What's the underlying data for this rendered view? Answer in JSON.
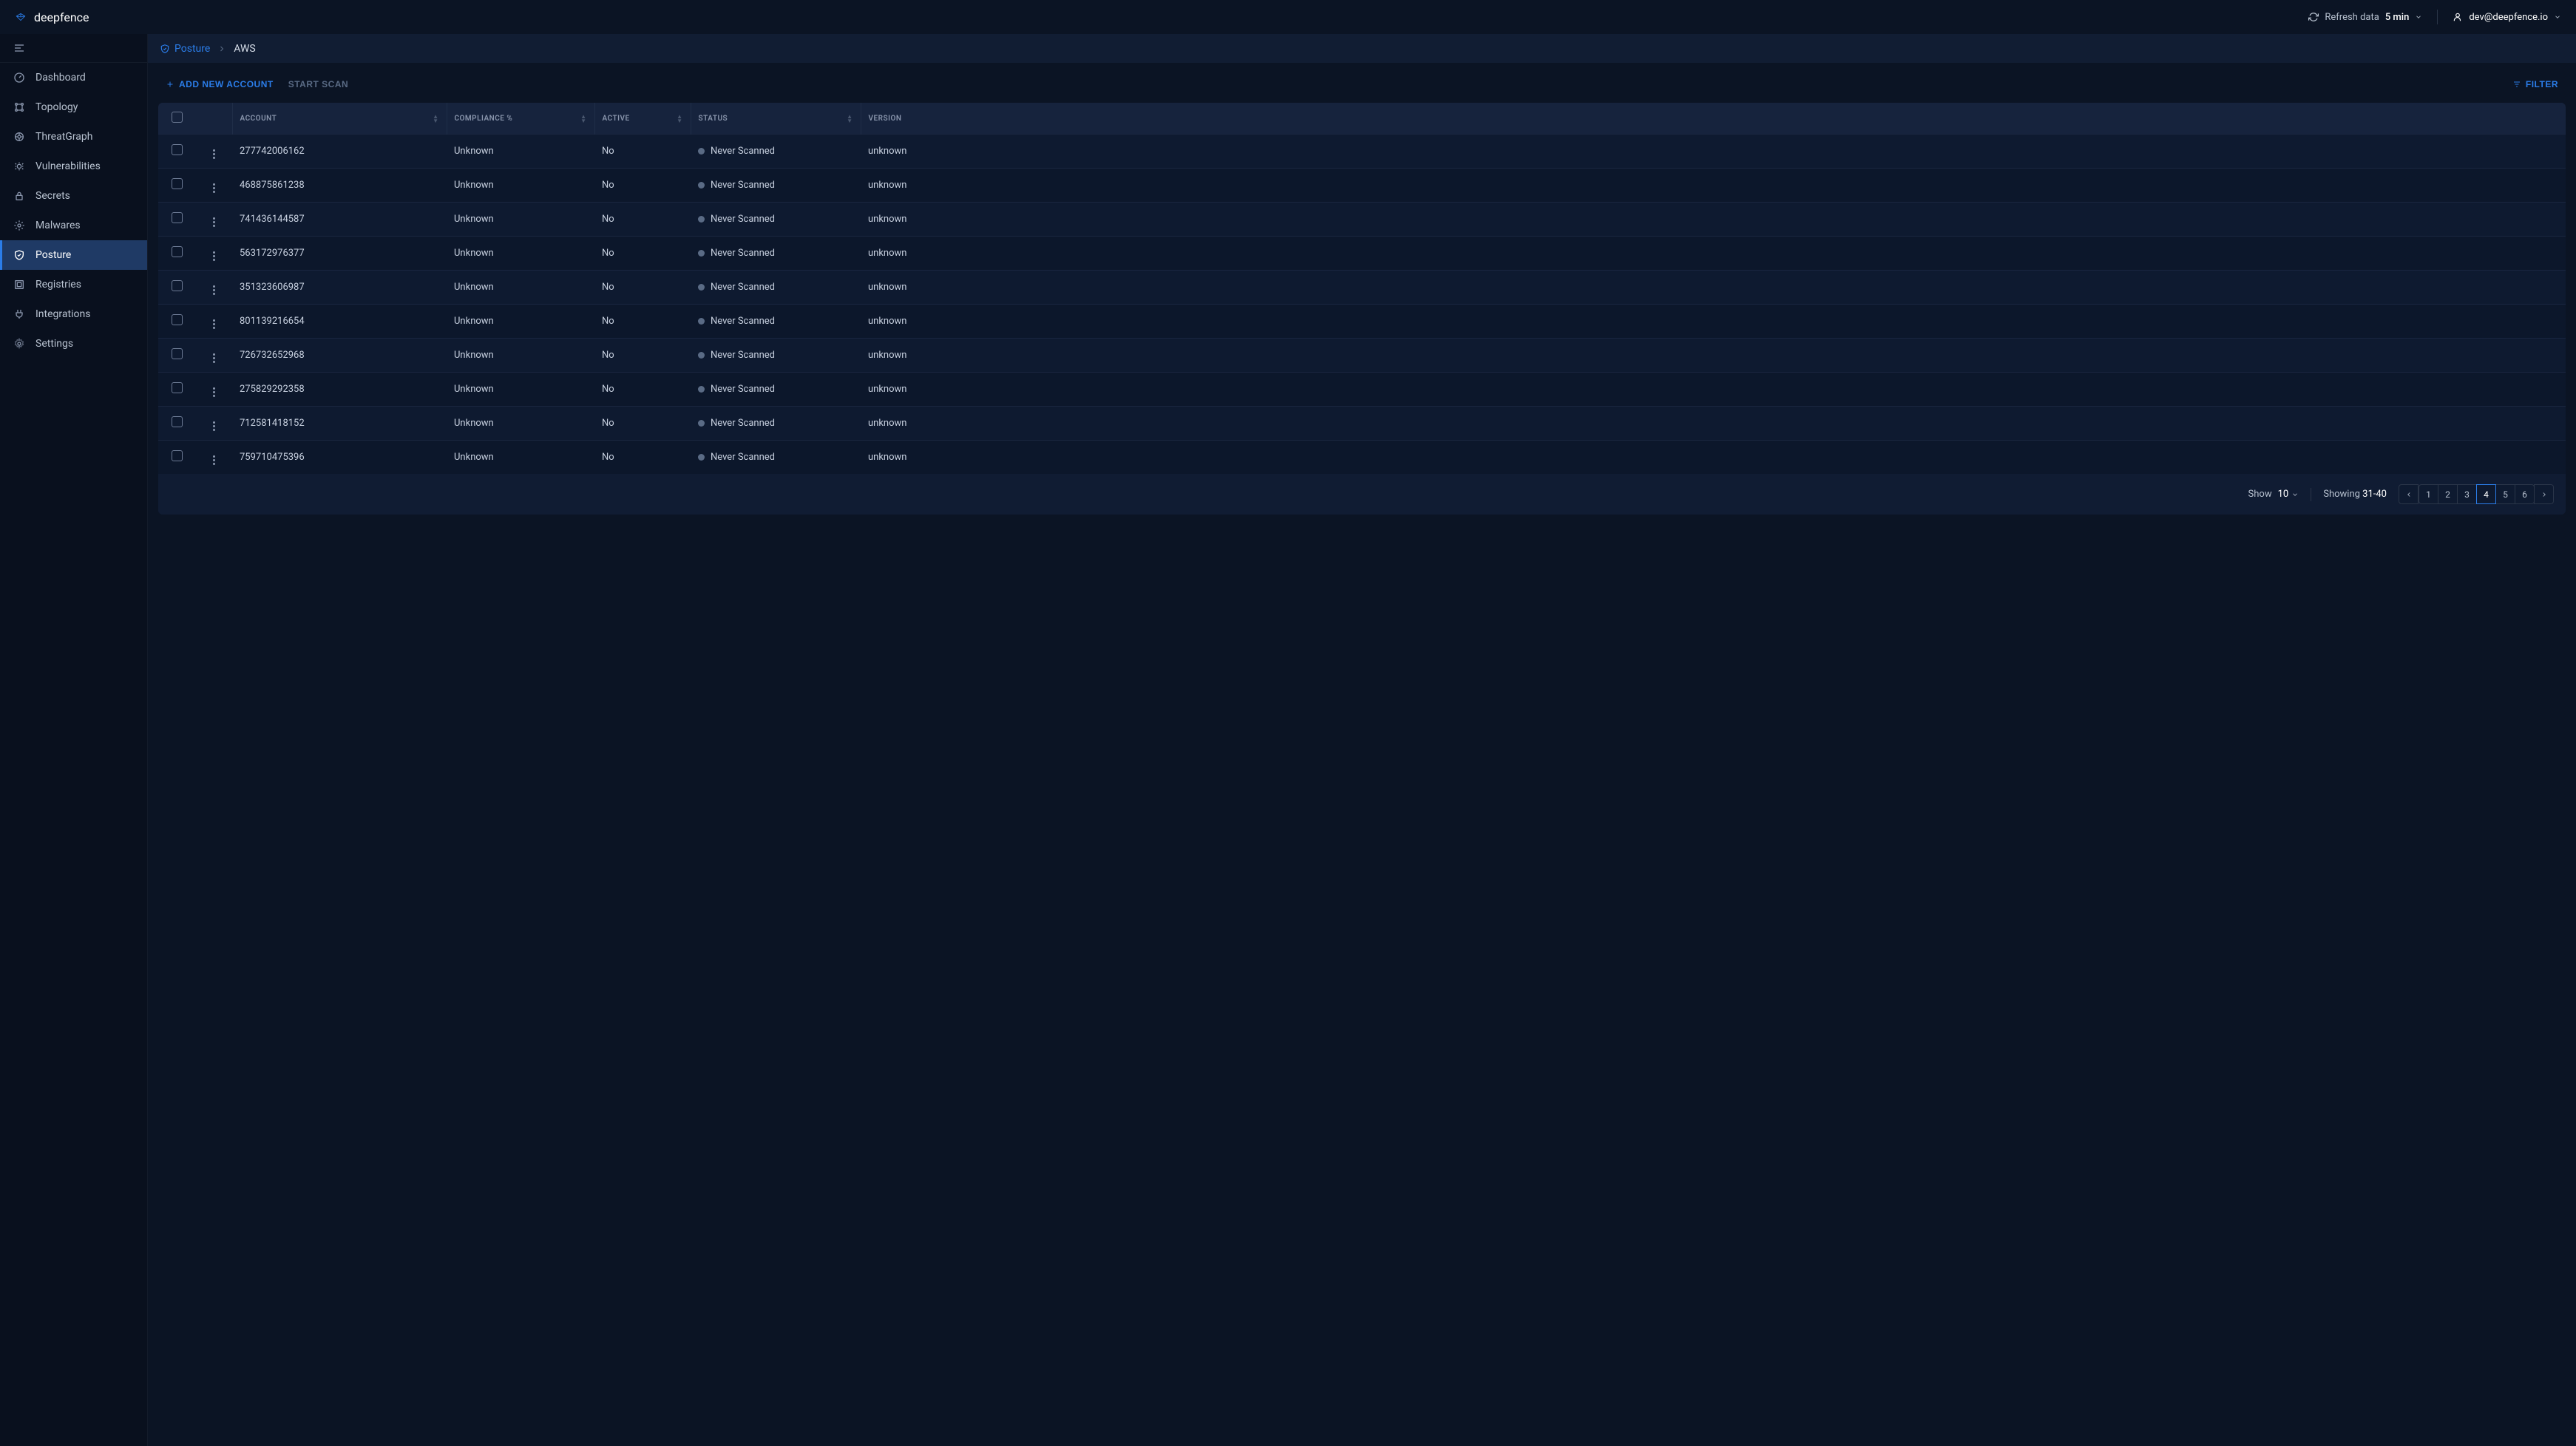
{
  "brand": {
    "name": "deepfence"
  },
  "header": {
    "refresh_label": "Refresh data",
    "refresh_value": "5 min",
    "user_email": "dev@deepfence.io"
  },
  "sidebar": {
    "items": [
      {
        "label": "Dashboard",
        "icon": "dashboard"
      },
      {
        "label": "Topology",
        "icon": "topology"
      },
      {
        "label": "ThreatGraph",
        "icon": "threatgraph"
      },
      {
        "label": "Vulnerabilities",
        "icon": "bug"
      },
      {
        "label": "Secrets",
        "icon": "lock"
      },
      {
        "label": "Malwares",
        "icon": "malware"
      },
      {
        "label": "Posture",
        "icon": "shield"
      },
      {
        "label": "Registries",
        "icon": "registries"
      },
      {
        "label": "Integrations",
        "icon": "integrations"
      },
      {
        "label": "Settings",
        "icon": "gear"
      }
    ]
  },
  "breadcrumb": {
    "root": "Posture",
    "current": "AWS"
  },
  "actions": {
    "add_account": "ADD NEW ACCOUNT",
    "start_scan": "START SCAN",
    "filter": "FILTER"
  },
  "table": {
    "columns": {
      "account": "Account",
      "compliance": "Compliance %",
      "active": "Active",
      "status": "Status",
      "version": "Version"
    },
    "rows": [
      {
        "account": "277742006162",
        "compliance": "Unknown",
        "active": "No",
        "status": "Never Scanned",
        "version": "unknown"
      },
      {
        "account": "468875861238",
        "compliance": "Unknown",
        "active": "No",
        "status": "Never Scanned",
        "version": "unknown"
      },
      {
        "account": "741436144587",
        "compliance": "Unknown",
        "active": "No",
        "status": "Never Scanned",
        "version": "unknown"
      },
      {
        "account": "563172976377",
        "compliance": "Unknown",
        "active": "No",
        "status": "Never Scanned",
        "version": "unknown"
      },
      {
        "account": "351323606987",
        "compliance": "Unknown",
        "active": "No",
        "status": "Never Scanned",
        "version": "unknown"
      },
      {
        "account": "801139216654",
        "compliance": "Unknown",
        "active": "No",
        "status": "Never Scanned",
        "version": "unknown"
      },
      {
        "account": "726732652968",
        "compliance": "Unknown",
        "active": "No",
        "status": "Never Scanned",
        "version": "unknown"
      },
      {
        "account": "275829292358",
        "compliance": "Unknown",
        "active": "No",
        "status": "Never Scanned",
        "version": "unknown"
      },
      {
        "account": "712581418152",
        "compliance": "Unknown",
        "active": "No",
        "status": "Never Scanned",
        "version": "unknown"
      },
      {
        "account": "759710475396",
        "compliance": "Unknown",
        "active": "No",
        "status": "Never Scanned",
        "version": "unknown"
      }
    ]
  },
  "pagination": {
    "show_label": "Show",
    "show_value": "10",
    "showing_label": "Showing",
    "showing_range": "31-40",
    "pages": [
      "1",
      "2",
      "3",
      "4",
      "5",
      "6"
    ],
    "active_page": "4"
  }
}
